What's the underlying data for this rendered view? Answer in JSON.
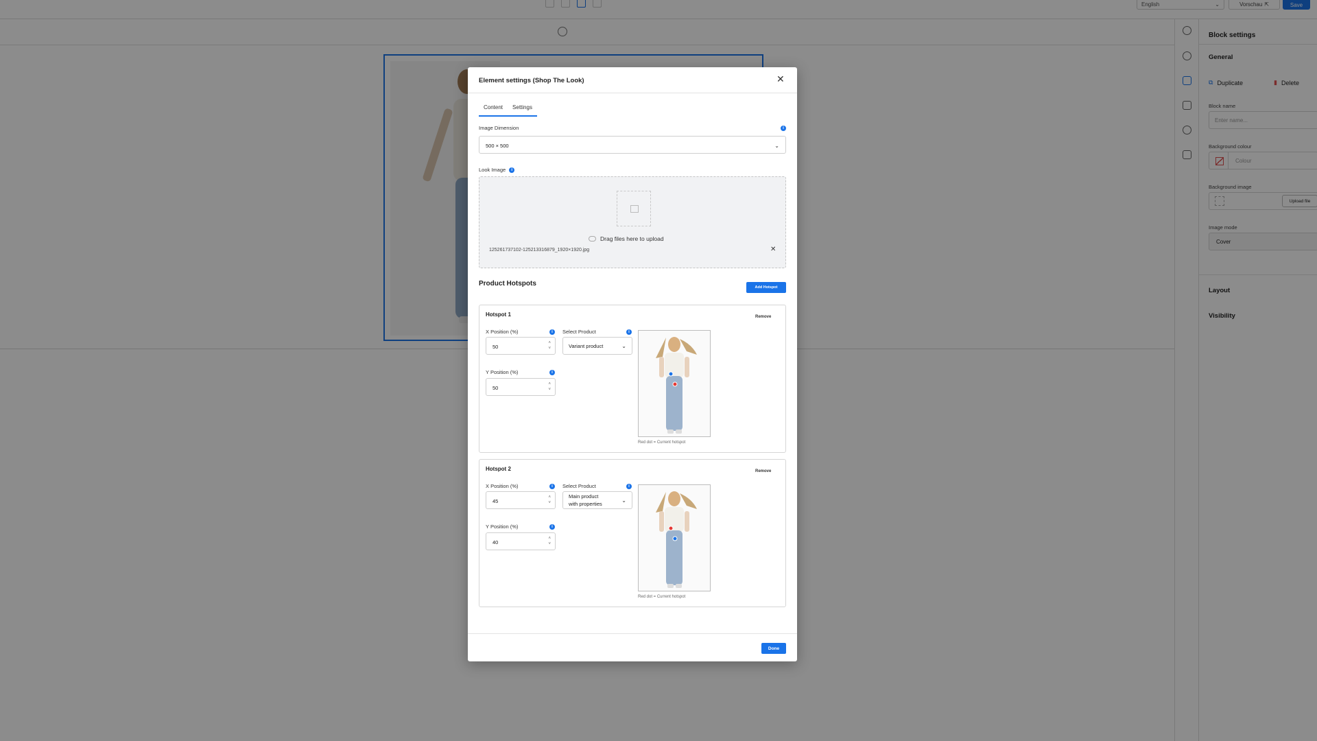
{
  "topbar": {
    "language": "English",
    "preview_label": "Vorschau",
    "save_label": "Save"
  },
  "right_panel": {
    "title": "Block settings",
    "general": "General",
    "duplicate": "Duplicate",
    "delete": "Delete",
    "block_name_label": "Block name",
    "block_name_placeholder": "Enter name...",
    "bg_colour_label": "Background colour",
    "bg_colour_placeholder": "Colour",
    "bg_image_label": "Background image",
    "upload_file": "Upload file",
    "image_mode_label": "Image mode",
    "image_mode_value": "Cover",
    "layout": "Layout",
    "visibility": "Visibility"
  },
  "modal": {
    "title": "Element settings (Shop The Look)",
    "tabs": [
      "Content",
      "Settings"
    ],
    "image_dimension_label": "Image Dimension",
    "image_dimension_value": "500 × 500",
    "look_image_label": "Look Image",
    "dropzone_text": "Drag files here to upload",
    "uploaded_file": "125261737102-125213316879_1920×1920.jpg",
    "hotspots_title": "Product Hotspots",
    "add_hotspot": "Add Hotspot",
    "done": "Done",
    "hotspots": [
      {
        "title": "Hotspot 1",
        "remove": "Remove",
        "x_label": "X Position (%)",
        "x_value": "50",
        "y_label": "Y Position (%)",
        "y_value": "50",
        "select_label": "Select Product",
        "select_line1": "Variant product",
        "select_line2": "",
        "caption": "Red dot = Current hotspot"
      },
      {
        "title": "Hotspot 2",
        "remove": "Remove",
        "x_label": "X Position (%)",
        "x_value": "45",
        "y_label": "Y Position (%)",
        "y_value": "40",
        "select_label": "Select Product",
        "select_line1": "Main product",
        "select_line2": "with properties",
        "caption": "Red dot = Current hotspot"
      }
    ]
  }
}
